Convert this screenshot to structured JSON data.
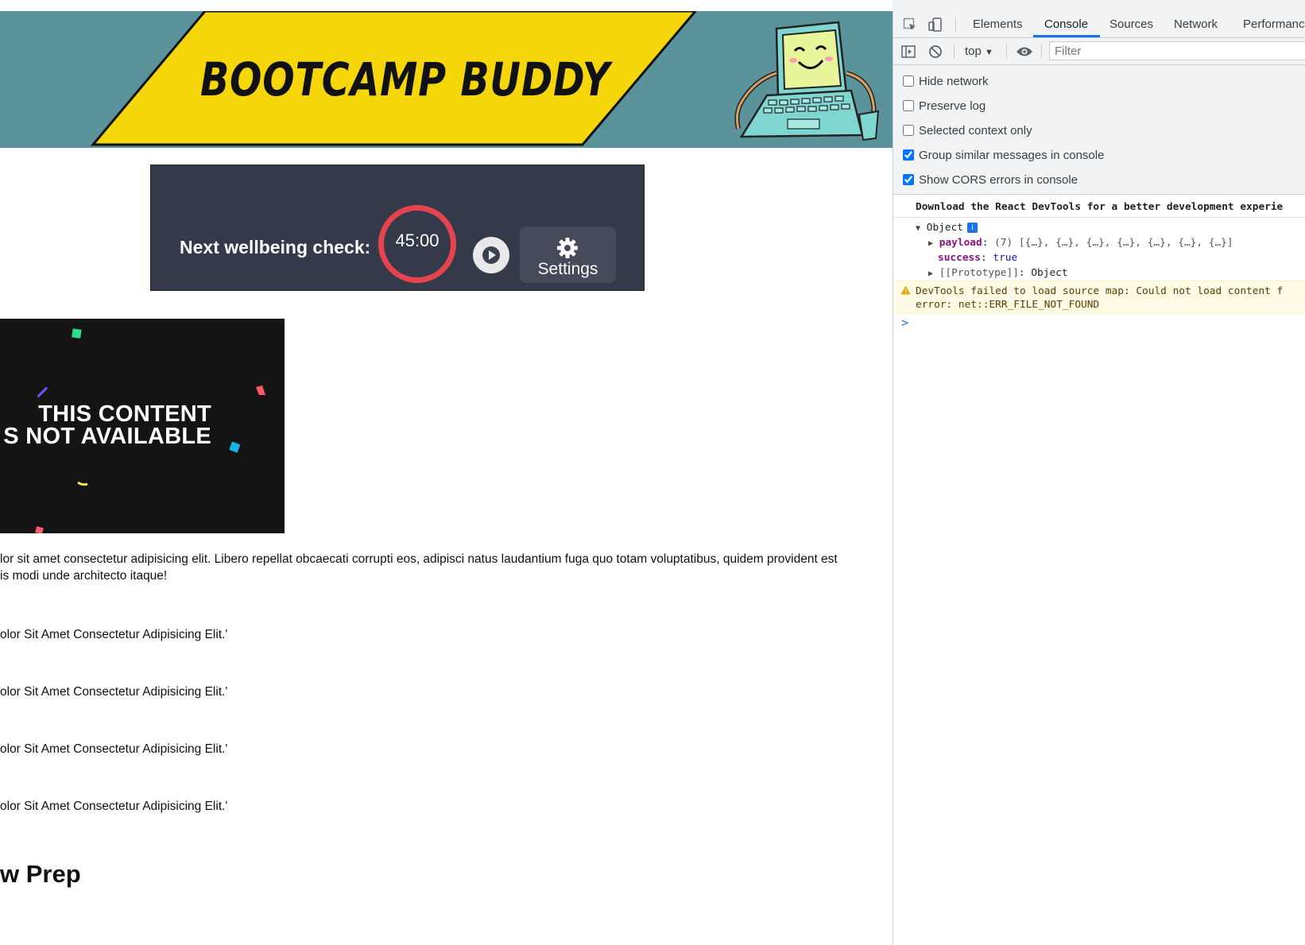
{
  "banner": {
    "title": "BOOTCAMP BUDDY"
  },
  "timer": {
    "label": "Next wellbeing check:",
    "value": "45:00",
    "settings_label": "Settings"
  },
  "video": {
    "line1": "THIS CONTENT",
    "line2": "S NOT AVAILABLE"
  },
  "content": {
    "paragraph_line1": "lor sit amet consectetur adipisicing elit. Libero repellat obcaecati corrupti eos, adipisci natus laudantium fuga quo totam voluptatibus, quidem provident est",
    "paragraph_line2": "is modi unde architecto itaque!",
    "quotes": [
      "olor Sit Amet Consectetur Adipisicing Elit.'",
      "olor Sit Amet Consectetur Adipisicing Elit.'",
      "olor Sit Amet Consectetur Adipisicing Elit.'",
      "olor Sit Amet Consectetur Adipisicing Elit.'"
    ],
    "section_heading": "w Prep"
  },
  "devtools": {
    "tabs": [
      "Elements",
      "Console",
      "Sources",
      "Network",
      "Performance"
    ],
    "active_tab": "Console",
    "context": "top",
    "filter_placeholder": "Filter",
    "options": [
      {
        "label": "Hide network",
        "checked": false
      },
      {
        "label": "Preserve log",
        "checked": false
      },
      {
        "label": "Selected context only",
        "checked": false
      },
      {
        "label": "Group similar messages in console",
        "checked": true
      },
      {
        "label": "Show CORS errors in console",
        "checked": true
      }
    ],
    "console": {
      "react_message": "Download the React DevTools for a better development experie",
      "object_label": "Object",
      "info_badge": "i",
      "payload_key": "payload",
      "payload_value": "(7) [{…}, {…}, {…}, {…}, {…}, {…}, {…}]",
      "success_key": "success",
      "success_value": "true",
      "prototype_key": "[[Prototype]]",
      "prototype_value": "Object",
      "warning_line1": "DevTools failed to load source map: Could not load content f",
      "warning_line2": "error: net::ERR_FILE_NOT_FOUND",
      "prompt": ">"
    }
  },
  "colors": {
    "banner_bg": "#5b939b",
    "banner_plate": "#f5d60a",
    "timer_panel": "#343a4a",
    "timer_ring": "#e5444f",
    "devtools_accent": "#1a73e8"
  }
}
